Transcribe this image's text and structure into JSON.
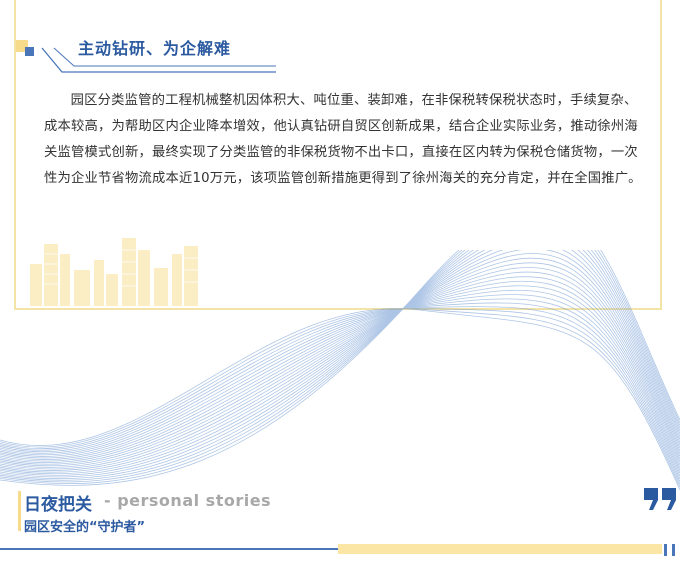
{
  "section": {
    "title": "主动钻研、为企解难"
  },
  "article": {
    "paragraph": "园区分类监管的工程机械整机因体积大、吨位重、装卸难，在非保税转保税状态时，手续复杂、成本较高，为帮助区内企业降本增效，他认真钻研自贸区创新成果，结合企业实际业务，推动徐州海关监管模式创新，最终实现了分类监管的非保税货物不出卡口，直接在区内转为保税仓储货物，一次性为企业节省物流成本近10万元，该项监管创新措施更得到了徐州海关的充分肯定，并在全国推广。"
  },
  "footer": {
    "title": "日夜把关",
    "english": "- personal stories",
    "subtitle": "园区安全的“守护者”"
  },
  "colors": {
    "accent_blue": "#2c5aa0",
    "accent_yellow": "#f6dc8a",
    "text": "#333333"
  },
  "icons": {
    "header_decoration": "squares-icon",
    "quote": "quote-icon"
  }
}
